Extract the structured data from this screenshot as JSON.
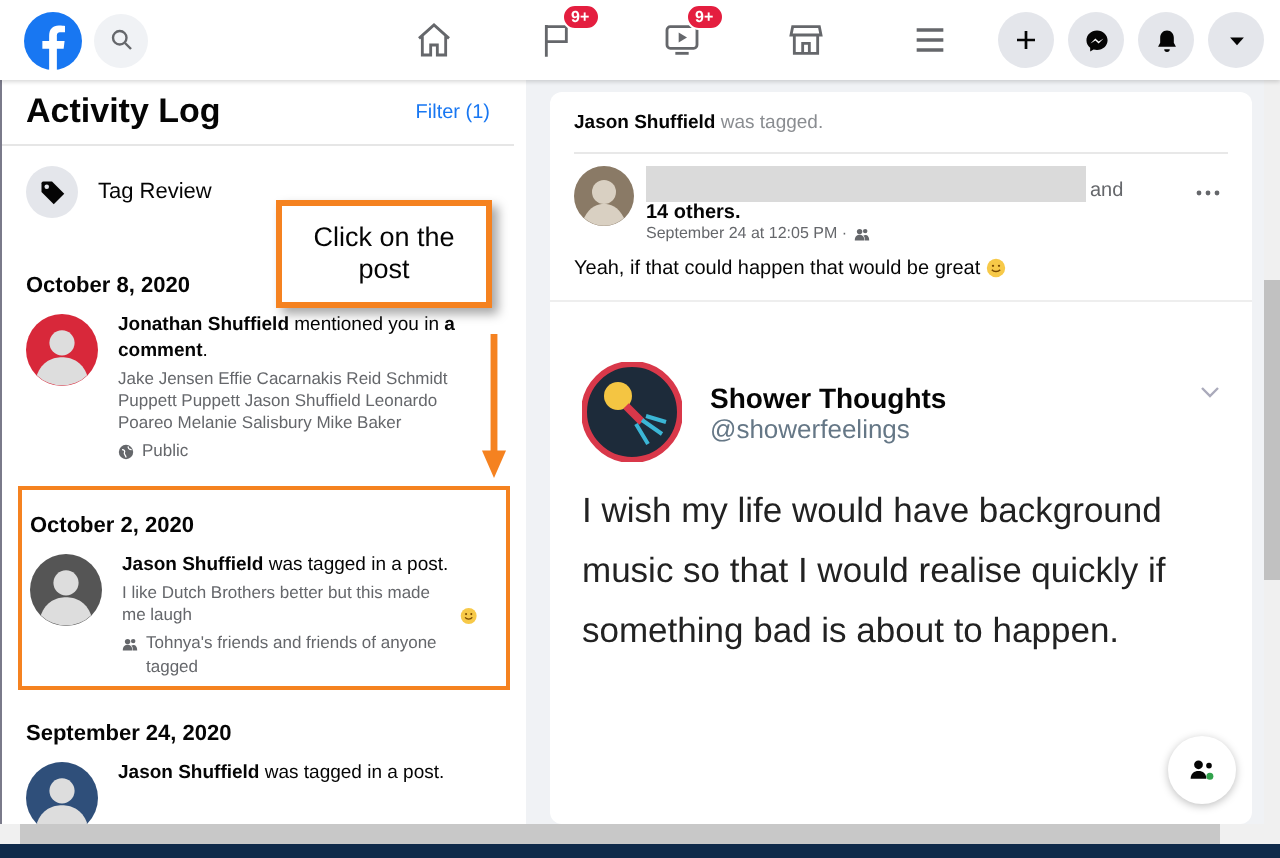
{
  "nav": {
    "pages_badge": "9+",
    "watch_badge": "9+"
  },
  "sidebar": {
    "title": "Activity Log",
    "filter": "Filter (1)",
    "menu": [
      {
        "label": "Tag Review"
      }
    ],
    "sections": [
      {
        "date": "October 8, 2020",
        "entries": [
          {
            "actor": "Jonathan Shuffield",
            "action": "mentioned you in **a comment**.",
            "detail": "Jake Jensen Effie Cacarnakis Reid Schmidt Puppett Puppett Jason Shuffield Leonardo Poareo Melanie Salisbury Mike Baker",
            "audience": {
              "kind": "public",
              "label": "Public"
            }
          }
        ]
      },
      {
        "date": "October 2, 2020",
        "entries": [
          {
            "actor": "Jason Shuffield",
            "action": "was tagged in a post.",
            "detail": "I like Dutch Brothers better but this made me laugh",
            "emoji": true,
            "audience": {
              "kind": "friends",
              "label": "Tohnya's friends and friends of anyone tagged"
            },
            "highlighted": true
          }
        ]
      },
      {
        "date": "September 24, 2020",
        "entries": [
          {
            "actor": "Jason Shuffield",
            "action": "was tagged in a post."
          }
        ]
      }
    ]
  },
  "annotation": {
    "text": "Click on the post"
  },
  "post": {
    "tag_actor": "Jason Shuffield",
    "tag_action": "was tagged.",
    "author_suffix": "and",
    "others": "14 others.",
    "time": "September 24 at 12:05 PM ·",
    "text": "Yeah, if that could happen that would be great",
    "emoji": true,
    "tweet": {
      "name": "Shower Thoughts",
      "handle": "@showerfeelings",
      "body": "I wish my life would have background music so that I would realise quickly if something bad is about to happen."
    }
  }
}
